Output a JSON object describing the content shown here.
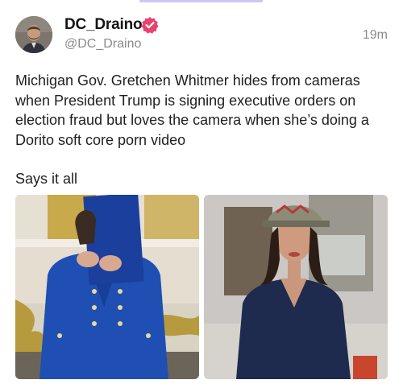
{
  "post": {
    "author": {
      "name": "DC_Draino",
      "handle": "@DC_Draino"
    },
    "timestamp": "19m",
    "body": [
      "Michigan Gov. Gretchen Whitmer hides from cameras when President Trump is signing executive orders on election fraud but loves the camera when she’s doing a Dorito soft core porn video",
      "Says it all"
    ]
  },
  "colors": {
    "verified_badge": "#e8436f",
    "accent_bar": "#cfc7f1",
    "secondary_text": "#8a8a8a"
  },
  "icons": {
    "verified": "verified-badge-icon"
  }
}
